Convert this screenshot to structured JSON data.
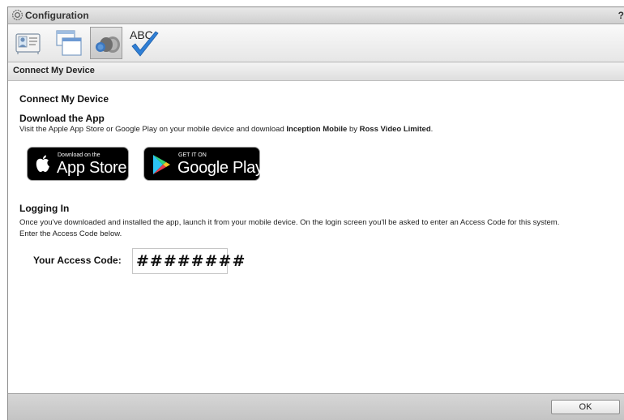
{
  "window": {
    "title": "Configuration",
    "help": "?"
  },
  "toolbar": {
    "buttons": [
      {
        "icon": "contact-card-icon",
        "active": false
      },
      {
        "icon": "windows-icon",
        "active": false
      },
      {
        "icon": "cloud-devices-icon",
        "active": true
      },
      {
        "icon": "abc-check-icon",
        "active": false
      }
    ],
    "abc_label": "ABC"
  },
  "section": {
    "title": "Connect My Device"
  },
  "content": {
    "heading": "Connect My Device",
    "download": {
      "heading": "Download the App",
      "text_before": "Visit the Apple App Store or Google Play on your mobile device and download ",
      "app_name": "Inception Mobile",
      "text_by": " by ",
      "vendor": "Ross Video Limited",
      "text_end": "."
    },
    "badges": {
      "apple": {
        "small": "Download on the",
        "big": "App Store"
      },
      "google": {
        "small": "GET IT ON",
        "big": "Google Play"
      }
    },
    "login": {
      "heading": "Logging In",
      "line1": "Once you've downloaded and installed the app, launch it from your mobile device. On the login screen you'll be asked to enter an Access Code for this system.",
      "line2": "Enter the Access Code below."
    },
    "access_code": {
      "label": "Your Access Code:",
      "value": "########"
    }
  },
  "footer": {
    "ok_label": "OK"
  },
  "colors": {
    "check_blue": "#2f7fd6",
    "cloud_blue": "#4c86c6",
    "cloud_gray": "#9a9a9a"
  }
}
